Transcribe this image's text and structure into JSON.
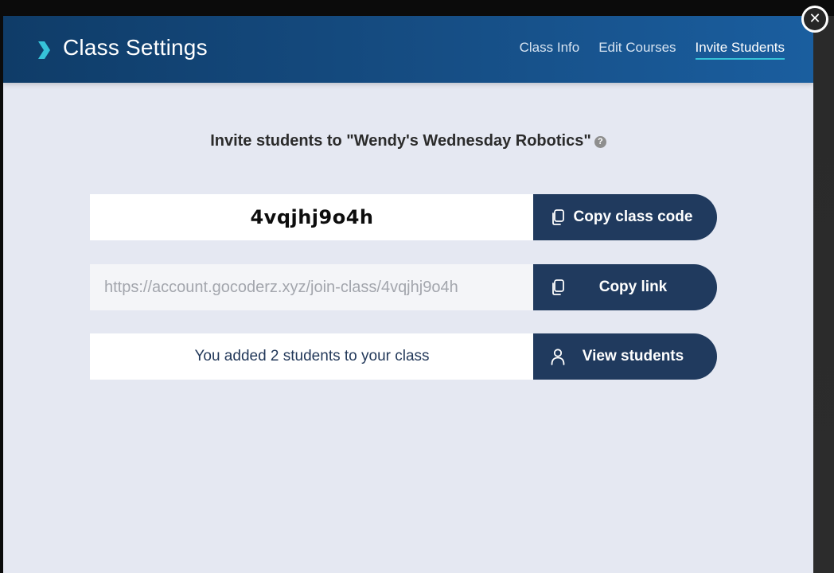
{
  "header": {
    "title": "Class Settings",
    "brand_icon": "chevron-right-icon",
    "accent_color": "#36c3d9",
    "tabs": [
      {
        "label": "Class Info",
        "active": false
      },
      {
        "label": "Edit Courses",
        "active": false
      },
      {
        "label": "Invite Students",
        "active": true
      }
    ]
  },
  "close": {
    "icon": "close-icon",
    "glyph": "✕"
  },
  "invite": {
    "heading": "Invite students to \"Wendy's Wednesday Robotics\"",
    "help_glyph": "?"
  },
  "rows": {
    "class_code": {
      "value": "4vqjhj9o4h",
      "button_label": "Copy class code",
      "icon": "copy-icon"
    },
    "join_link": {
      "value": "https://account.gocoderz.xyz/join-class/4vqjhj9o4h",
      "button_label": "Copy link",
      "icon": "copy-icon"
    },
    "students": {
      "text": "You added 2 students to your class",
      "button_label": "View students",
      "icon": "user-icon"
    }
  },
  "colors": {
    "header_start": "#0f3c68",
    "header_end": "#1a5e9f",
    "button_bg": "#203a5e",
    "modal_bg": "#e5e8f2"
  }
}
